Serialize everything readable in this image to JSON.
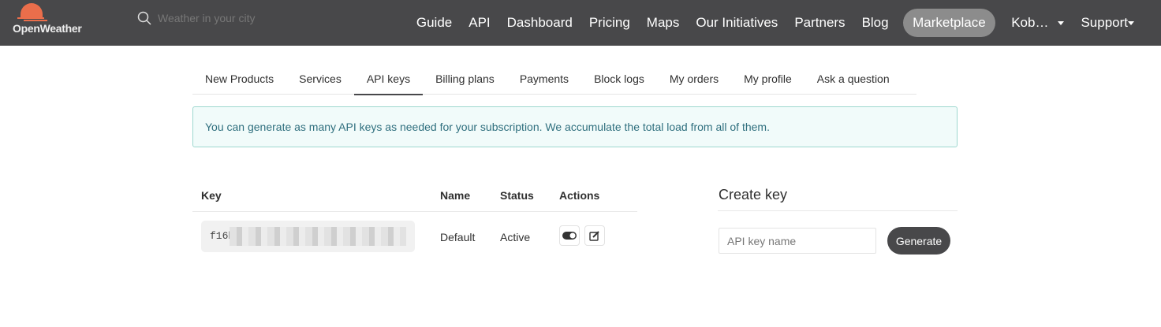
{
  "brand": {
    "name": "OpenWeather",
    "accent": "#eb6e4b"
  },
  "search": {
    "placeholder": "Weather in your city"
  },
  "nav": {
    "items": [
      "Guide",
      "API",
      "Dashboard",
      "Pricing",
      "Maps",
      "Our Initiatives",
      "Partners",
      "Blog"
    ],
    "marketplace": "Marketplace",
    "user": "Kob…",
    "support": "Support"
  },
  "tabs": [
    "New Products",
    "Services",
    "API keys",
    "Billing plans",
    "Payments",
    "Block logs",
    "My orders",
    "My profile",
    "Ask a question"
  ],
  "alert": "You can generate as many API keys as needed for your subscription. We accumulate the total load from all of them.",
  "table": {
    "headers": [
      "Key",
      "Name",
      "Status",
      "Actions"
    ],
    "rows": [
      {
        "key": "f16b",
        "name": "Default",
        "status": "Active"
      }
    ]
  },
  "create": {
    "title": "Create key",
    "placeholder": "API key name",
    "button": "Generate"
  }
}
